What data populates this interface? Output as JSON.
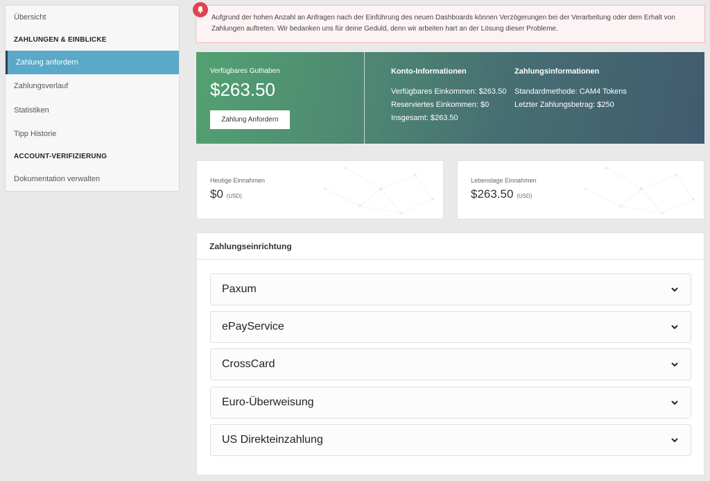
{
  "sidebar": {
    "items": [
      {
        "label": "Übersicht",
        "type": "item"
      },
      {
        "label": "ZAHLUNGEN & EINBLICKE",
        "type": "heading"
      },
      {
        "label": "Zahlung anfordern",
        "type": "item",
        "active": true
      },
      {
        "label": "Zahlungsverlauf",
        "type": "item"
      },
      {
        "label": "Statistiken",
        "type": "item"
      },
      {
        "label": "Tipp Historie",
        "type": "item"
      },
      {
        "label": "ACCOUNT-VERIFIZIERUNG",
        "type": "heading"
      },
      {
        "label": "Dokumentation verwalten",
        "type": "item"
      }
    ]
  },
  "alert": {
    "icon": "bell-icon",
    "text": "Aufgrund der hohen Anzahl an Anfragen nach der Einführung des neuen Dashboards können Verzögerungen bei der Verarbeitung oder dem Erhalt von Zahlungen auftreten. Wir bedanken uns für deine Geduld, denn wir arbeiten hart an der Lösung dieser Probleme."
  },
  "balance": {
    "label": "Verfügbares Guthaben",
    "value": "$263.50",
    "button_label": "Zahlung Anfordern"
  },
  "account_info": {
    "title": "Konto-Informationen",
    "lines": [
      "Verfügbares Einkommen: $263.50",
      "Reserviertes Einkommen: $0",
      "Insgesamt: $263.50"
    ]
  },
  "payment_info": {
    "title": "Zahlungsinformationen",
    "lines": [
      "Standardmethode: CAM4 Tokens",
      "Letzter Zahlungsbetrag: $250"
    ]
  },
  "stats": {
    "today": {
      "label": "Heutige Einnahmen",
      "value": "$0",
      "unit": "(USD)"
    },
    "lifetime": {
      "label": "Lebenslage Einnahmen",
      "value": "$263.50",
      "unit": "(USD)"
    }
  },
  "setup": {
    "title": "Zahlungseinrichtung",
    "methods": [
      "Paxum",
      "ePayService",
      "CrossCard",
      "Euro-Überweisung",
      "US Direkteinzahlung"
    ]
  },
  "colors": {
    "active_nav": "#5aa9c8",
    "banner_start": "#52a171",
    "banner_end": "#415b6f",
    "alert_bg": "#fbf3f4",
    "alert_border": "#f0b8bf",
    "bell": "#e0444e"
  }
}
